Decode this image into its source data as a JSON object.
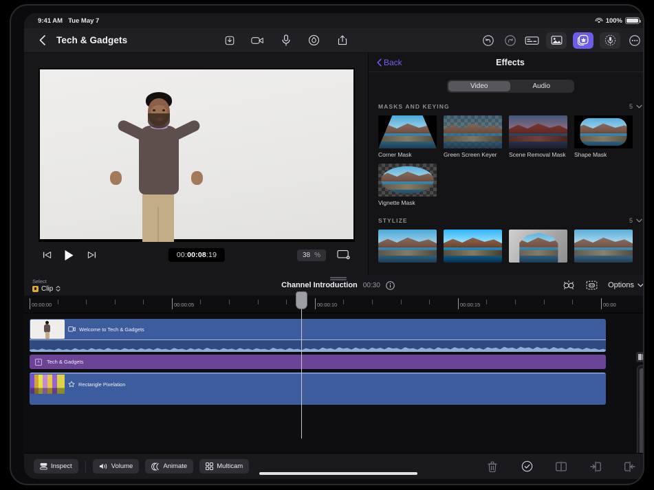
{
  "status_bar": {
    "time": "9:41 AM",
    "date": "Tue May 7",
    "battery": "100%",
    "wifi_icon": "wifi-icon",
    "battery_icon": "battery-icon"
  },
  "toolbar": {
    "back_icon": "chevron-left-icon",
    "project_title": "Tech & Gadgets",
    "left_actions": [
      {
        "name": "import-media-button",
        "icon": "tray-download-icon"
      },
      {
        "name": "record-video-button",
        "icon": "video-camera-icon"
      },
      {
        "name": "record-voiceover-button",
        "icon": "microphone-icon"
      },
      {
        "name": "color-adjust-button",
        "icon": "droplet-circle-icon"
      },
      {
        "name": "share-export-button",
        "icon": "share-up-icon"
      }
    ],
    "right_actions": [
      {
        "name": "undo-button",
        "icon": "undo-arrow-icon",
        "active": false
      },
      {
        "name": "redo-button",
        "icon": "redo-arrow-icon",
        "active": false
      },
      {
        "name": "titles-button",
        "icon": "title-card-icon",
        "active": false
      },
      {
        "name": "media-library-button",
        "icon": "photo-icon",
        "active": false
      },
      {
        "name": "effects-button",
        "icon": "effects-star-icon",
        "active": true
      },
      {
        "name": "audio-button",
        "icon": "audio-meter-icon",
        "active": false
      },
      {
        "name": "more-options-button",
        "icon": "ellipsis-circle-icon",
        "active": false
      }
    ],
    "accent_color": "#6c5ce7"
  },
  "preview": {
    "timecode": {
      "prefix": "00:",
      "highlight": "00:08",
      "suffix": ":19",
      "full": "00:00:08:19"
    },
    "zoom_value": "38",
    "zoom_unit": "%",
    "controls": [
      {
        "name": "skip-to-start-button",
        "icon": "skip-back-icon"
      },
      {
        "name": "play-button",
        "icon": "play-icon"
      },
      {
        "name": "skip-to-end-button",
        "icon": "skip-forward-icon"
      }
    ],
    "fit_icon": "fit-to-screen-icon"
  },
  "effects_panel": {
    "back_label": "Back",
    "back_icon": "chevron-left-icon",
    "title": "Effects",
    "tabs": [
      {
        "label": "Video",
        "selected": true
      },
      {
        "label": "Audio",
        "selected": false
      }
    ],
    "sections": [
      {
        "title": "MASKS AND KEYING",
        "count": "5",
        "chevron_icon": "chevron-down-icon",
        "items": [
          {
            "label": "Corner Mask",
            "art": "trapezoid"
          },
          {
            "label": "Green Screen Keyer",
            "art": "checker"
          },
          {
            "label": "Scene Removal Mask",
            "art": "red"
          },
          {
            "label": "Shape Mask",
            "art": "rounded"
          },
          {
            "label": "Vignette Mask",
            "art": "vignette"
          }
        ]
      },
      {
        "title": "STYLIZE",
        "count": "5",
        "chevron_icon": "chevron-down-icon",
        "items": [
          {
            "label": "",
            "art": "plain"
          },
          {
            "label": "",
            "art": "plain"
          },
          {
            "label": "",
            "art": "arch"
          },
          {
            "label": "",
            "art": "plain"
          }
        ]
      }
    ]
  },
  "timeline": {
    "select_label": "Select",
    "select_value": "Clip",
    "select_chevron_icon": "chevron-up-down-icon",
    "project_name": "Channel Introduction",
    "duration": "00:30",
    "info_icon": "info-circle-icon",
    "right_actions": [
      {
        "name": "keyframe-button",
        "icon": "keyframe-icon"
      },
      {
        "name": "snapping-button",
        "icon": "magnet-snap-icon"
      }
    ],
    "options_label": "Options",
    "options_chevron_icon": "chevron-down-icon",
    "ruler_labels": [
      "00:00:00",
      "00:00:05",
      "00:00:10",
      "00:00:15",
      "00:00"
    ],
    "tracks": [
      {
        "name": "Welcome to Tech & Gadgets",
        "type": "video",
        "icon": "video-clip-icon",
        "color": "#3d5c9e"
      },
      {
        "name": "Tech & Gadgets",
        "type": "title",
        "icon": "title-badge-icon",
        "color": "#6b4397"
      },
      {
        "name": "Rectangle Pixelation",
        "type": "effect",
        "icon": "star-outline-icon",
        "color": "#3d5c9e"
      }
    ],
    "scroll_zoom_icon": "zoom-track-icon"
  },
  "bottom_bar": {
    "left_buttons": [
      {
        "label": "Inspect",
        "icon": "inspect-icon"
      },
      {
        "label": "Volume",
        "icon": "speaker-icon"
      },
      {
        "label": "Animate",
        "icon": "animate-icon"
      },
      {
        "label": "Multicam",
        "icon": "multicam-grid-icon"
      }
    ],
    "right_buttons": [
      {
        "name": "delete-button",
        "icon": "trash-icon"
      },
      {
        "name": "confirm-button",
        "icon": "checkmark-circle-icon"
      },
      {
        "name": "split-clip-button",
        "icon": "split-clip-icon"
      },
      {
        "name": "trim-in-button",
        "icon": "trim-in-icon"
      },
      {
        "name": "trim-out-button",
        "icon": "trim-out-icon"
      }
    ]
  }
}
